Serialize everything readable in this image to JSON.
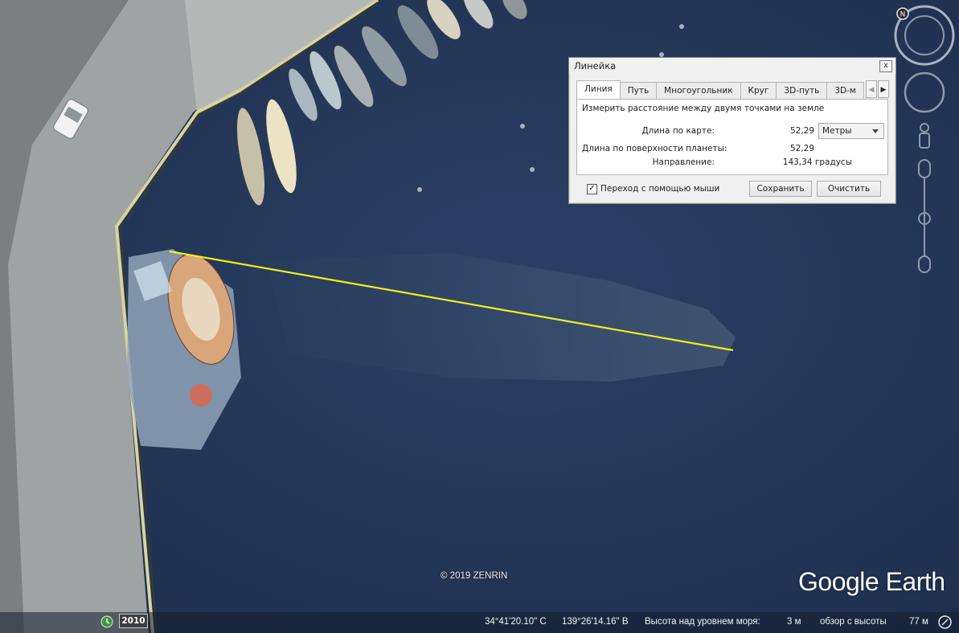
{
  "dialog": {
    "title": "Линейка",
    "close_label": "x",
    "tabs": [
      "Линия",
      "Путь",
      "Многоугольник",
      "Круг",
      "3D-путь",
      "3D-м"
    ],
    "active_tab": "Линия",
    "description": "Измерить расстояние между двумя точками на земле",
    "map_length_label": "Длина по карте:",
    "map_length_value": "52,29",
    "unit": "Метры",
    "ground_length_label": "Длина по поверхности планеты:",
    "ground_length_value": "52,29",
    "heading_label": "Направление:",
    "heading_value": "143,34 градусы",
    "mouse_nav_label": "Переход с помощью мыши",
    "mouse_nav_checked": true,
    "save_label": "Сохранить",
    "clear_label": "Очистить"
  },
  "map": {
    "copyright": "© 2019 ZENRIN",
    "logo": "Google Earth",
    "measure_line_color": "#f2ef1b",
    "water_color": "#24385a",
    "pier_color": "#a8aaa9"
  },
  "status": {
    "year": "2010",
    "lat": "34°41'20.10\" С",
    "lon": "139°26'14.16\" В",
    "elevation_label": "Высота над уровнем моря:",
    "elevation_value": "3 м",
    "eye_alt_label": "обзор с высоты",
    "eye_alt_value": "77 м"
  }
}
